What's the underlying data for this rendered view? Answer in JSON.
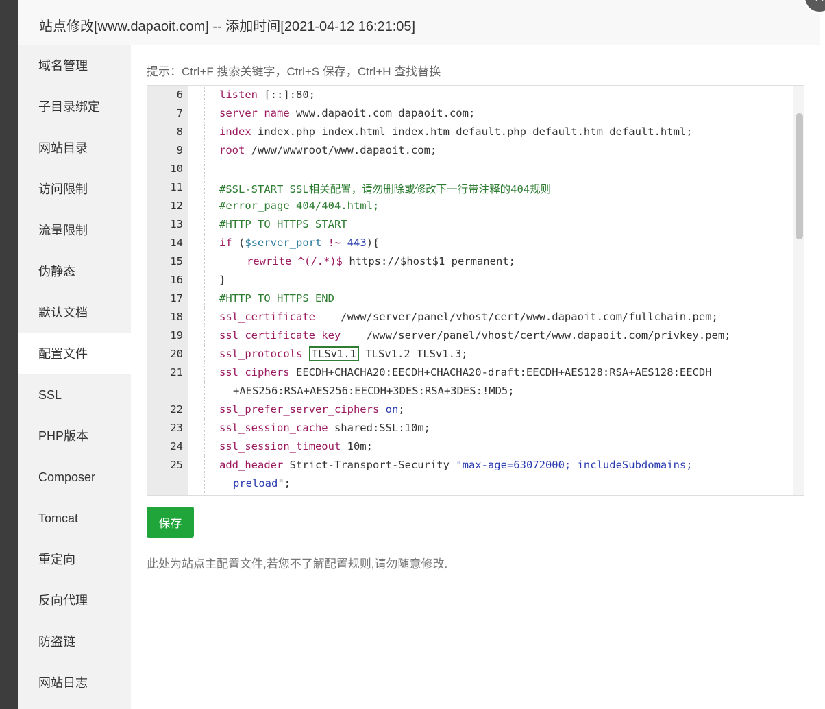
{
  "dialog": {
    "title": "站点修改[www.dapaoit.com] -- 添加时间[2021-04-12 16:21:05]",
    "close_label": "×"
  },
  "sidebar": {
    "items": [
      {
        "label": "域名管理"
      },
      {
        "label": "子目录绑定"
      },
      {
        "label": "网站目录"
      },
      {
        "label": "访问限制"
      },
      {
        "label": "流量限制"
      },
      {
        "label": "伪静态"
      },
      {
        "label": "默认文档"
      },
      {
        "label": "配置文件",
        "active": true
      },
      {
        "label": "SSL"
      },
      {
        "label": "PHP版本"
      },
      {
        "label": "Composer"
      },
      {
        "label": "Tomcat"
      },
      {
        "label": "重定向"
      },
      {
        "label": "反向代理"
      },
      {
        "label": "防盗链"
      },
      {
        "label": "网站日志"
      }
    ]
  },
  "content": {
    "hint": "提示：Ctrl+F 搜索关键字，Ctrl+S 保存，Ctrl+H 查找替换",
    "save_label": "保存",
    "note": "此处为站点主配置文件,若您不了解配置规则,请勿随意修改."
  },
  "editor": {
    "lines": [
      {
        "n": "6",
        "tokens": [
          [
            "kw",
            "listen"
          ],
          [
            "p",
            " [::]:80;"
          ]
        ]
      },
      {
        "n": "7",
        "tokens": [
          [
            "kw",
            "server_name"
          ],
          [
            "p",
            " www.dapaoit.com dapaoit.com;"
          ]
        ]
      },
      {
        "n": "8",
        "tokens": [
          [
            "kw",
            "index"
          ],
          [
            "p",
            " index.php index.html index.htm default.php default.htm default.html;"
          ]
        ]
      },
      {
        "n": "9",
        "tokens": [
          [
            "kw",
            "root"
          ],
          [
            "p",
            " /www/wwwroot/www.dapaoit.com;"
          ]
        ]
      },
      {
        "n": "10",
        "tokens": []
      },
      {
        "n": "11",
        "tokens": [
          [
            "cm",
            "#SSL-START SSL相关配置，请勿删除或修改下一行带注释的404规则"
          ]
        ]
      },
      {
        "n": "12",
        "tokens": [
          [
            "cm",
            "#error_page 404/404.html;"
          ]
        ]
      },
      {
        "n": "13",
        "tokens": [
          [
            "cm",
            "#HTTP_TO_HTTPS_START"
          ]
        ]
      },
      {
        "n": "14",
        "tokens": [
          [
            "kw",
            "if"
          ],
          [
            "p",
            " ("
          ],
          [
            "var",
            "$server_port"
          ],
          [
            "p",
            " "
          ],
          [
            "kw",
            "!~"
          ],
          [
            "p",
            " "
          ],
          [
            "num",
            "443"
          ],
          [
            "p",
            "){"
          ]
        ]
      },
      {
        "n": "15",
        "indent2": true,
        "tokens": [
          [
            "kw",
            "rewrite"
          ],
          [
            "p",
            " "
          ],
          [
            "kw",
            "^(/.*)$"
          ],
          [
            "p",
            " https://$host$1 permanent;"
          ]
        ]
      },
      {
        "n": "16",
        "tokens": [
          [
            "p",
            "}"
          ]
        ]
      },
      {
        "n": "17",
        "tokens": [
          [
            "cm",
            "#HTTP_TO_HTTPS_END"
          ]
        ]
      },
      {
        "n": "18",
        "tokens": [
          [
            "kw",
            "ssl_certificate"
          ],
          [
            "p",
            "    /www/server/panel/vhost/cert/www.dapaoit.com/fullchain.pem;"
          ]
        ]
      },
      {
        "n": "19",
        "tokens": [
          [
            "kw",
            "ssl_certificate_key"
          ],
          [
            "p",
            "    /www/server/panel/vhost/cert/www.dapaoit.com/privkey.pem;"
          ]
        ]
      },
      {
        "n": "20",
        "tokens": [
          [
            "kw",
            "ssl_protocols"
          ],
          [
            "p",
            " "
          ],
          [
            "hl",
            "TLSv1.1"
          ],
          [
            "p",
            " TLSv1.2 TLSv1.3;"
          ]
        ]
      },
      {
        "n": "21",
        "tokens": [
          [
            "kw",
            "ssl_ciphers"
          ],
          [
            "p",
            " EECDH+CHACHA20:EECDH+CHACHA20-draft:EECDH+AES128:RSA+AES128:EECDH"
          ]
        ]
      },
      {
        "n": "",
        "cont": true,
        "tokens": [
          [
            "p",
            "+AES256:RSA+AES256:EECDH+3DES:RSA+3DES:!MD5;"
          ]
        ]
      },
      {
        "n": "22",
        "tokens": [
          [
            "kw",
            "ssl_prefer_server_ciphers"
          ],
          [
            "p",
            " "
          ],
          [
            "str",
            "on"
          ],
          [
            "p",
            ";"
          ]
        ]
      },
      {
        "n": "23",
        "tokens": [
          [
            "kw",
            "ssl_session_cache"
          ],
          [
            "p",
            " shared:SSL:10m;"
          ]
        ]
      },
      {
        "n": "24",
        "tokens": [
          [
            "kw",
            "ssl_session_timeout"
          ],
          [
            "p",
            " 10m;"
          ]
        ]
      },
      {
        "n": "25",
        "tokens": [
          [
            "kw",
            "add_header"
          ],
          [
            "p",
            " Strict-Transport-Security "
          ],
          [
            "str",
            "\"max-age=63072000; includeSubdomains;"
          ]
        ]
      },
      {
        "n": "",
        "cont": true,
        "tokens": [
          [
            "str",
            "preload"
          ],
          [
            "p",
            "\";"
          ]
        ]
      }
    ]
  },
  "colors": {
    "accent_green": "#20a53a",
    "keyword": "#9b1a5e",
    "comment": "#2e7d32",
    "string": "#2a3bb0",
    "variable": "#2b7a9b"
  }
}
